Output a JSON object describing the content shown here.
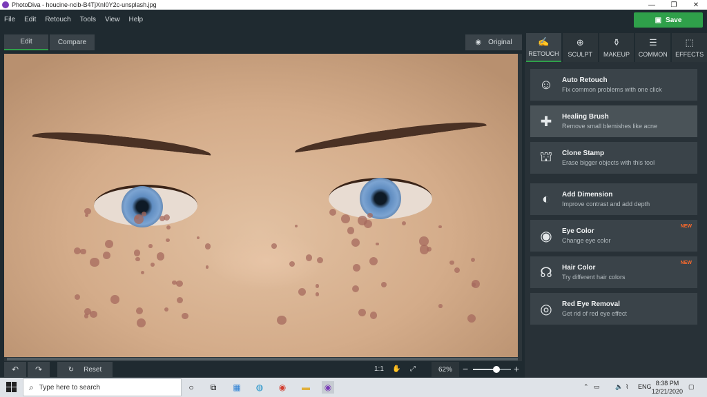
{
  "window": {
    "title": "PhotoDiva - houcine-ncib-B4TjXnI0Y2c-unsplash.jpg"
  },
  "menu": [
    "File",
    "Edit",
    "Retouch",
    "Tools",
    "View",
    "Help"
  ],
  "save_label": "Save",
  "view_tabs": {
    "edit": "Edit",
    "compare": "Compare",
    "original": "Original"
  },
  "bottom": {
    "reset": "Reset",
    "ratio": "1:1",
    "zoom": "62%",
    "zoom_fraction": 0.62
  },
  "right_tabs": [
    {
      "label": "RETOUCH",
      "icon": "✍"
    },
    {
      "label": "SCULPT",
      "icon": "⊕"
    },
    {
      "label": "MAKEUP",
      "icon": "⚱"
    },
    {
      "label": "COMMON",
      "icon": "☰"
    },
    {
      "label": "EFFECTS",
      "icon": "⬚"
    }
  ],
  "tools": [
    {
      "name": "Auto Retouch",
      "desc": "Fix common problems with one click",
      "icon": "☺",
      "badge": ""
    },
    {
      "name": "Healing Brush",
      "desc": "Remove small blemishes like acne",
      "icon": "✚",
      "badge": ""
    },
    {
      "name": "Clone Stamp",
      "desc": "Erase bigger objects with this tool",
      "icon": "⛫",
      "badge": ""
    },
    {
      "name": "Add Dimension",
      "desc": "Improve contrast and add depth",
      "icon": "◐",
      "badge": ""
    },
    {
      "name": "Eye Color",
      "desc": "Change eye color",
      "icon": "◉",
      "badge": "NEW"
    },
    {
      "name": "Hair Color",
      "desc": "Try different hair colors",
      "icon": "☊",
      "badge": "NEW"
    },
    {
      "name": "Red Eye Removal",
      "desc": "Get rid of red eye effect",
      "icon": "◎",
      "badge": ""
    }
  ],
  "taskbar": {
    "search_placeholder": "Type here to search",
    "lang": "ENG",
    "time": "8:38 PM",
    "date": "12/21/2020"
  },
  "colors": {
    "accent": "#2fa04a",
    "new_badge": "#ff6a2b"
  }
}
